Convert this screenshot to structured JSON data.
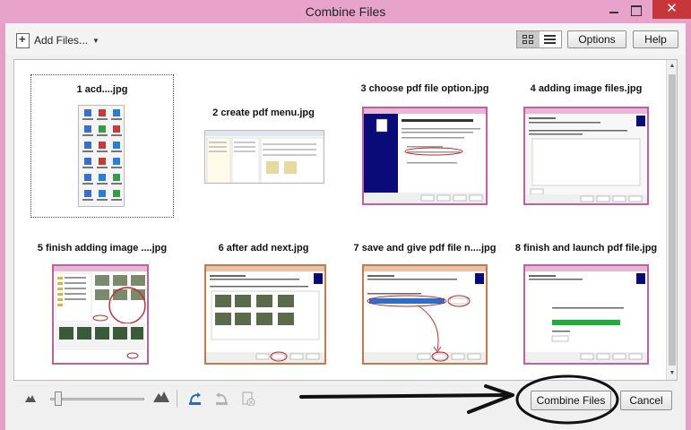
{
  "window": {
    "title": "Combine Files",
    "close_glyph": "✕",
    "help_glyph": "?"
  },
  "toolbar": {
    "add_files_label": "Add Files...",
    "add_files_icon": "add-document-icon",
    "options_label": "Options",
    "help_label": "Help",
    "view_modes": [
      "thumbnail-view-icon",
      "list-view-icon"
    ]
  },
  "files": [
    {
      "label": "1 acd....jpg"
    },
    {
      "label": "2 create pdf menu.jpg"
    },
    {
      "label": "3 choose pdf file option.jpg"
    },
    {
      "label": "4 adding image files.jpg"
    },
    {
      "label": "5 finish adding image ....jpg"
    },
    {
      "label": "6 after add next.jpg"
    },
    {
      "label": "7 save and give pdf file n....jpg"
    },
    {
      "label": "8 finish and launch pdf file.jpg"
    }
  ],
  "footer": {
    "combine_label": "Combine Files",
    "cancel_label": "Cancel",
    "icons": [
      "small-mountain-icon",
      "large-mountain-icon",
      "rotate-left-icon",
      "rotate-right-icon",
      "delete-page-icon"
    ]
  },
  "colors": {
    "frame": "#e4a0c7",
    "close": "#c7363a",
    "annotation": "#111111",
    "wizard_blue": "#0a0a78",
    "progress_green": "#1fae3a"
  }
}
